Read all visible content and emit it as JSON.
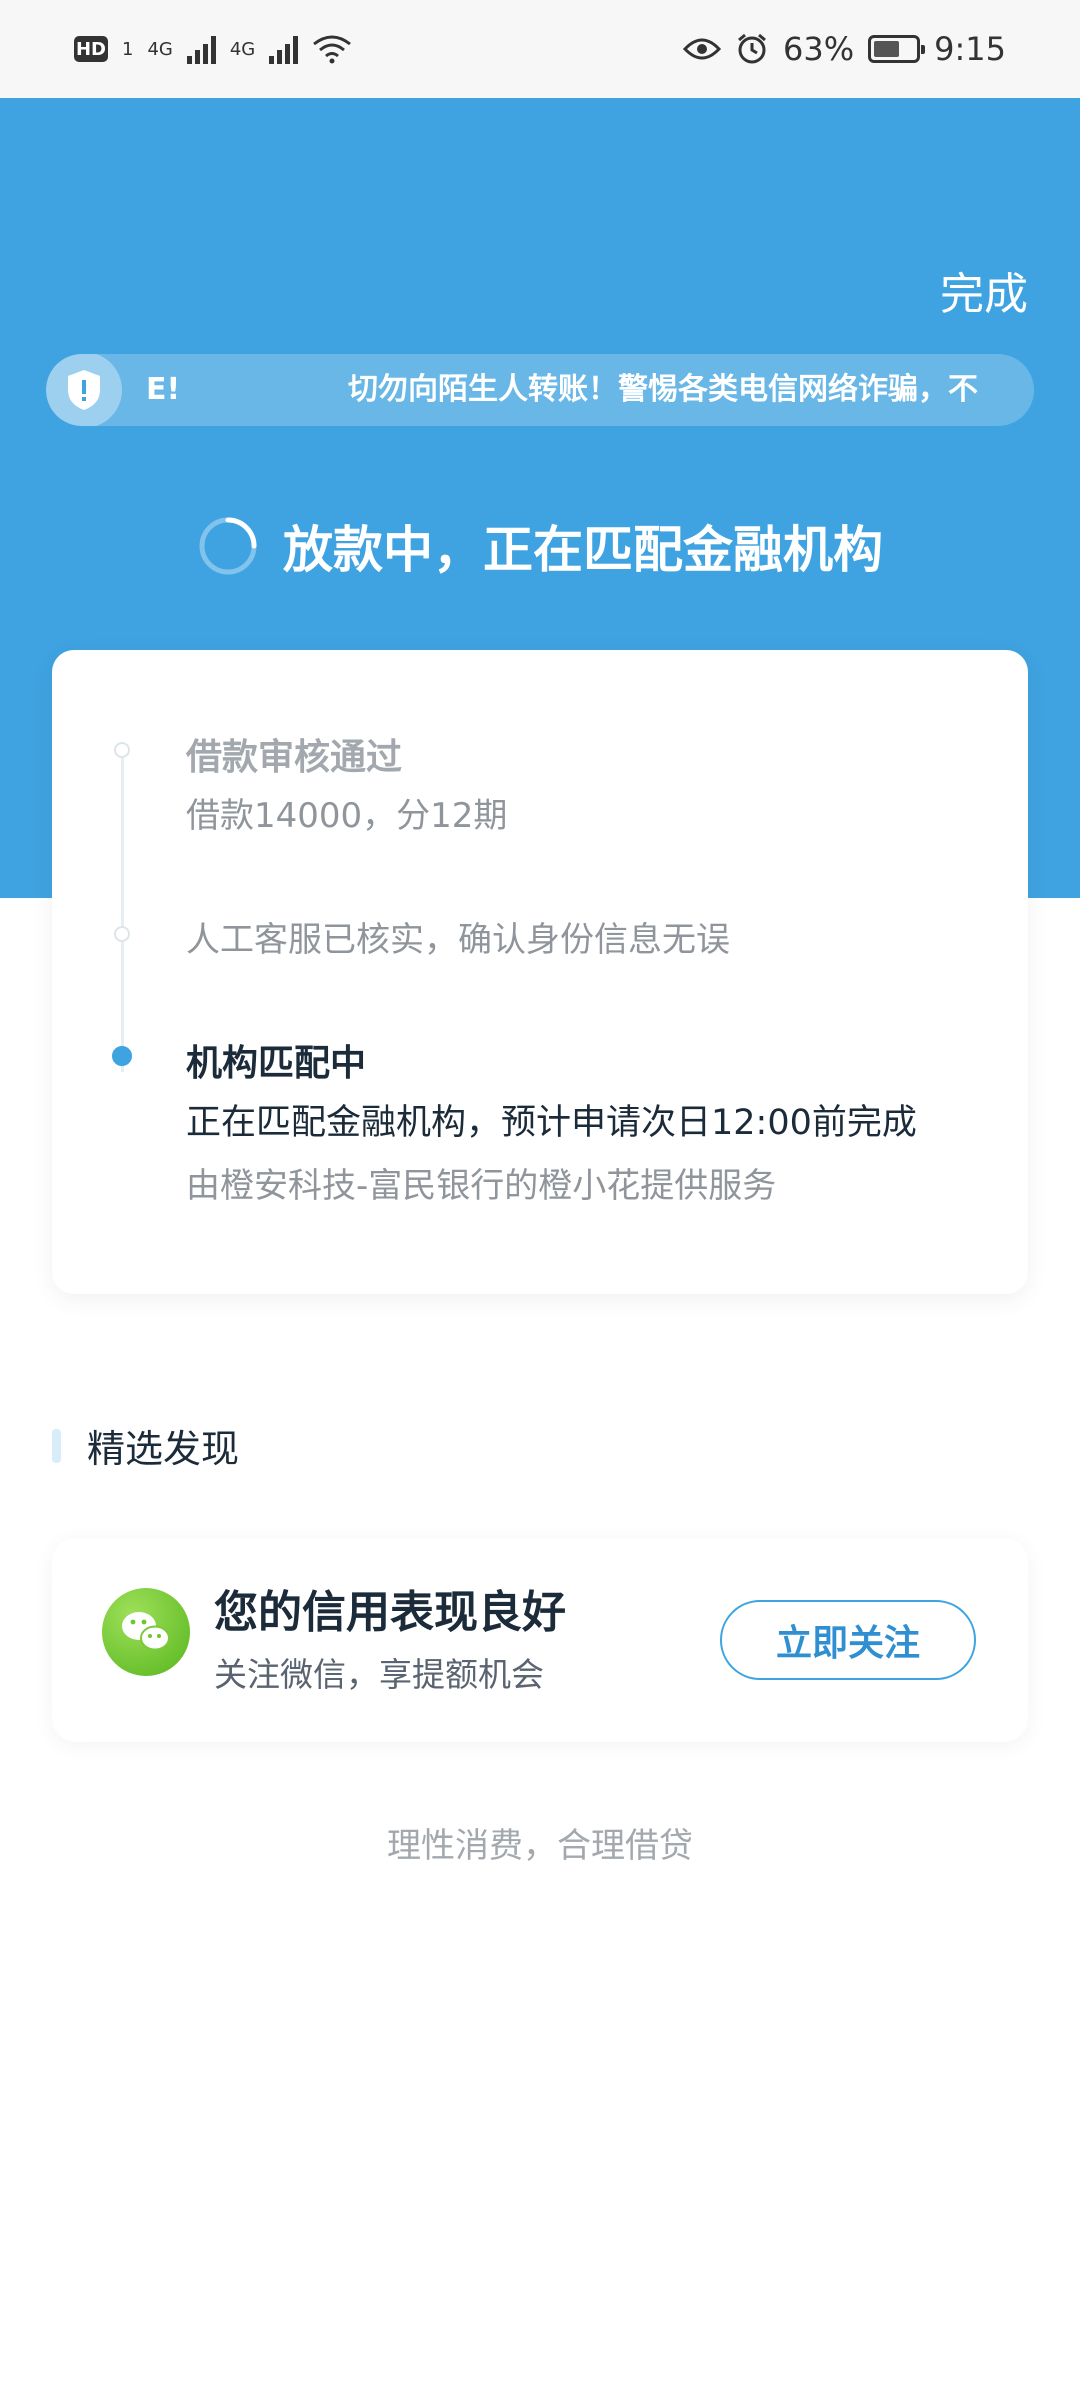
{
  "status_bar": {
    "hd": "HD",
    "hd_sub": "1",
    "net1": "4G",
    "net2": "4G",
    "battery_percent": "63%",
    "battery_level": 0.63,
    "time": "9:15"
  },
  "header": {
    "done_label": "完成",
    "notice_text_a": "E!",
    "notice_text_b": "切勿向陌生人转账！警惕各类电信网络诈骗，不",
    "loading_status": "放款中，正在匹配金融机构"
  },
  "progress": {
    "steps": [
      {
        "title": "借款审核通过",
        "sub": "借款14000，分12期"
      },
      {
        "sub": "人工客服已核实，确认身份信息无误"
      },
      {
        "title": "机构匹配中",
        "desc": "正在匹配金融机构，预计申请次日12:00前完成",
        "provider": "由橙安科技-富民银行的橙小花提供服务"
      }
    ]
  },
  "discover": {
    "section_title": "精选发现",
    "promo": {
      "title": "您的信用表现良好",
      "subtitle": "关注微信，享提额机会",
      "button_label": "立即关注"
    }
  },
  "footer": {
    "note": "理性消费，合理借贷"
  },
  "colors": {
    "primary": "#3fa3e1",
    "wechat_green": "#6cc62c"
  }
}
